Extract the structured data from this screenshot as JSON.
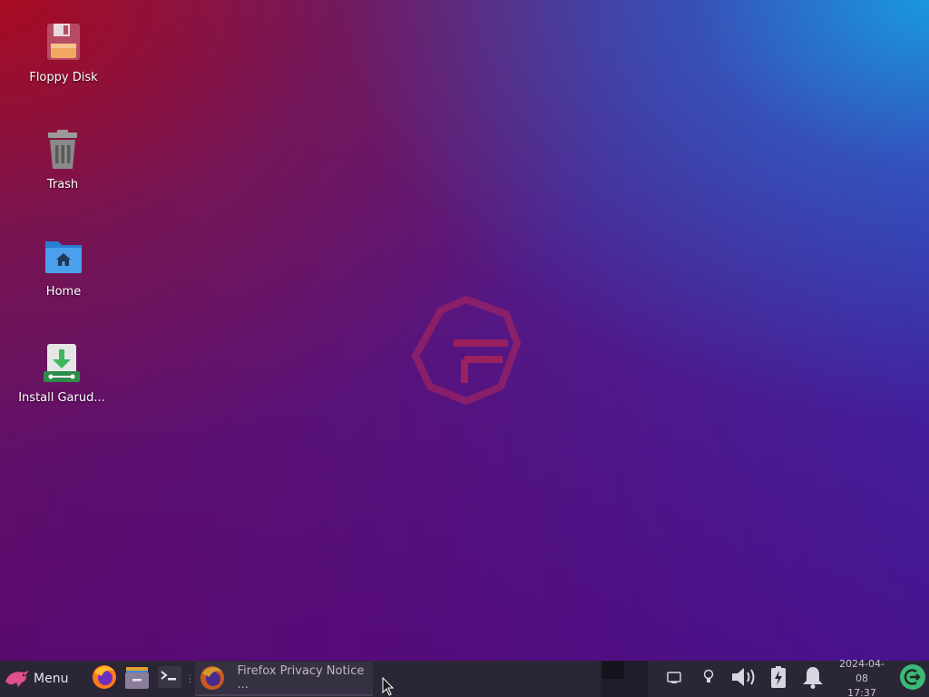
{
  "desktop": {
    "icons": [
      {
        "label": "Floppy Disk",
        "icon": "floppy-disk-icon"
      },
      {
        "label": "Trash",
        "icon": "trash-icon"
      },
      {
        "label": "Home",
        "icon": "home-folder-icon"
      },
      {
        "label": "Install Garud...",
        "icon": "installer-icon"
      }
    ],
    "wallpaper_logo": "garuda-logo"
  },
  "panel": {
    "menu_label": "Menu",
    "launchers": [
      {
        "icon": "firefox-icon"
      },
      {
        "icon": "file-manager-icon"
      },
      {
        "icon": "terminal-icon"
      }
    ],
    "tasks": [
      {
        "label": "Firefox Privacy Notice ...",
        "icon": "firefox-icon"
      }
    ],
    "tray": {
      "icons": [
        "network-icon",
        "lightbulb-icon",
        "volume-icon",
        "battery-charging-icon",
        "notification-bell-icon"
      ],
      "date": "2024-04-08",
      "time": "17:37",
      "power_icon": "logout-icon"
    }
  },
  "colors": {
    "panel_bg": "#2b2636",
    "task_bg": "#353042",
    "accent_green": "#3cb878"
  }
}
